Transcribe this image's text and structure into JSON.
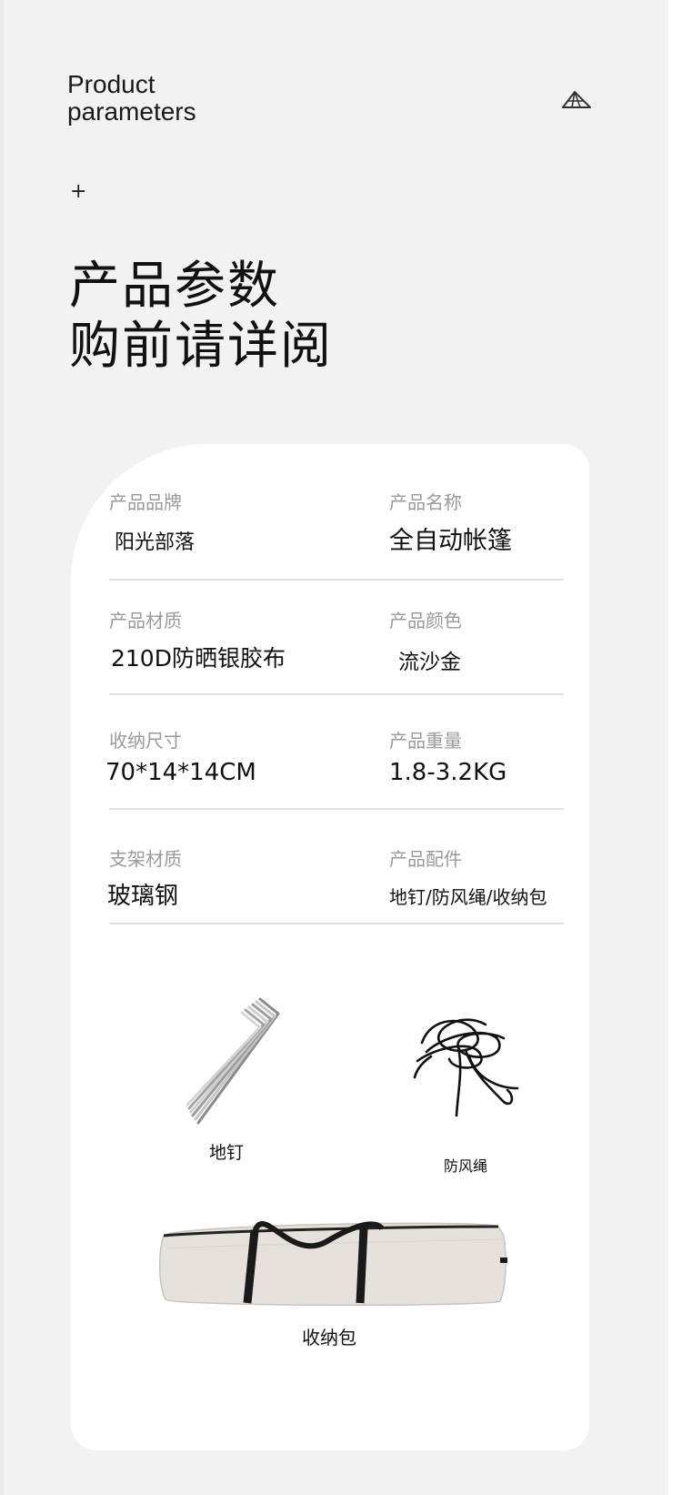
{
  "header": {
    "title_en_line1": "Product",
    "title_en_line2": "parameters",
    "plus": "+",
    "title_cn_line1": "产品参数",
    "title_cn_line2": "购前请详阅"
  },
  "specs": [
    {
      "label": "产品品牌",
      "value": "阳光部落"
    },
    {
      "label": "产品名称",
      "value": "全自动帐篷"
    },
    {
      "label": "产品材质",
      "value": "210D防晒银胶布"
    },
    {
      "label": "产品颜色",
      "value": "流沙金"
    },
    {
      "label": "收纳尺寸",
      "value": "70*14*14CM"
    },
    {
      "label": "产品重量",
      "value": "1.8-3.2KG"
    },
    {
      "label": "支架材质",
      "value": "玻璃钢"
    },
    {
      "label": "产品配件",
      "value": "地钉/防风绳/收纳包"
    }
  ],
  "accessories": [
    {
      "label": "地钉",
      "icon": "tent-stakes-icon"
    },
    {
      "label": "防风绳",
      "icon": "wind-rope-icon"
    },
    {
      "label": "收纳包",
      "icon": "storage-bag-icon"
    }
  ],
  "colors": {
    "background": "#f2f2f2",
    "card": "#ffffff",
    "label_gray": "#9a9a9a",
    "divider": "#e2e2e2",
    "bag_fabric": "#e6e1da",
    "strap": "#1a1a1a"
  }
}
